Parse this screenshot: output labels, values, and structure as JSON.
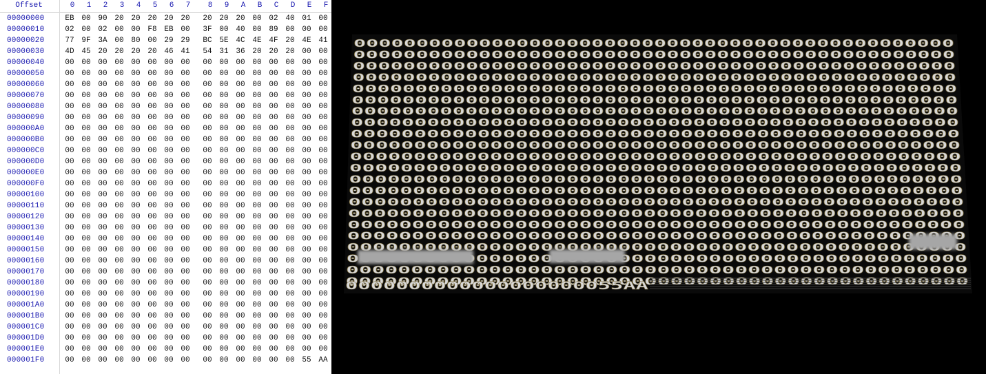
{
  "hex_editor": {
    "offset_header": "Offset",
    "column_headers": [
      "0",
      "1",
      "2",
      "3",
      "4",
      "5",
      "6",
      "7",
      "8",
      "9",
      "A",
      "B",
      "C",
      "D",
      "E",
      "F"
    ],
    "rows": [
      {
        "offset": "00000000",
        "bytes": [
          "EB",
          "00",
          "90",
          "20",
          "20",
          "20",
          "20",
          "20",
          "20",
          "20",
          "20",
          "00",
          "02",
          "40",
          "01",
          "00"
        ]
      },
      {
        "offset": "00000010",
        "bytes": [
          "02",
          "00",
          "02",
          "00",
          "00",
          "F8",
          "EB",
          "00",
          "3F",
          "00",
          "40",
          "00",
          "89",
          "00",
          "00",
          "00"
        ]
      },
      {
        "offset": "00000020",
        "bytes": [
          "77",
          "9F",
          "3A",
          "00",
          "80",
          "00",
          "29",
          "29",
          "BC",
          "5E",
          "4C",
          "4E",
          "4F",
          "20",
          "4E",
          "41"
        ]
      },
      {
        "offset": "00000030",
        "bytes": [
          "4D",
          "45",
          "20",
          "20",
          "20",
          "20",
          "46",
          "41",
          "54",
          "31",
          "36",
          "20",
          "20",
          "20",
          "00",
          "00"
        ]
      },
      {
        "offset": "00000040",
        "bytes": [
          "00",
          "00",
          "00",
          "00",
          "00",
          "00",
          "00",
          "00",
          "00",
          "00",
          "00",
          "00",
          "00",
          "00",
          "00",
          "00"
        ]
      },
      {
        "offset": "00000050",
        "bytes": [
          "00",
          "00",
          "00",
          "00",
          "00",
          "00",
          "00",
          "00",
          "00",
          "00",
          "00",
          "00",
          "00",
          "00",
          "00",
          "00"
        ]
      },
      {
        "offset": "00000060",
        "bytes": [
          "00",
          "00",
          "00",
          "00",
          "00",
          "00",
          "00",
          "00",
          "00",
          "00",
          "00",
          "00",
          "00",
          "00",
          "00",
          "00"
        ]
      },
      {
        "offset": "00000070",
        "bytes": [
          "00",
          "00",
          "00",
          "00",
          "00",
          "00",
          "00",
          "00",
          "00",
          "00",
          "00",
          "00",
          "00",
          "00",
          "00",
          "00"
        ]
      },
      {
        "offset": "00000080",
        "bytes": [
          "00",
          "00",
          "00",
          "00",
          "00",
          "00",
          "00",
          "00",
          "00",
          "00",
          "00",
          "00",
          "00",
          "00",
          "00",
          "00"
        ]
      },
      {
        "offset": "00000090",
        "bytes": [
          "00",
          "00",
          "00",
          "00",
          "00",
          "00",
          "00",
          "00",
          "00",
          "00",
          "00",
          "00",
          "00",
          "00",
          "00",
          "00"
        ]
      },
      {
        "offset": "000000A0",
        "bytes": [
          "00",
          "00",
          "00",
          "00",
          "00",
          "00",
          "00",
          "00",
          "00",
          "00",
          "00",
          "00",
          "00",
          "00",
          "00",
          "00"
        ]
      },
      {
        "offset": "000000B0",
        "bytes": [
          "00",
          "00",
          "00",
          "00",
          "00",
          "00",
          "00",
          "00",
          "00",
          "00",
          "00",
          "00",
          "00",
          "00",
          "00",
          "00"
        ]
      },
      {
        "offset": "000000C0",
        "bytes": [
          "00",
          "00",
          "00",
          "00",
          "00",
          "00",
          "00",
          "00",
          "00",
          "00",
          "00",
          "00",
          "00",
          "00",
          "00",
          "00"
        ]
      },
      {
        "offset": "000000D0",
        "bytes": [
          "00",
          "00",
          "00",
          "00",
          "00",
          "00",
          "00",
          "00",
          "00",
          "00",
          "00",
          "00",
          "00",
          "00",
          "00",
          "00"
        ]
      },
      {
        "offset": "000000E0",
        "bytes": [
          "00",
          "00",
          "00",
          "00",
          "00",
          "00",
          "00",
          "00",
          "00",
          "00",
          "00",
          "00",
          "00",
          "00",
          "00",
          "00"
        ]
      },
      {
        "offset": "000000F0",
        "bytes": [
          "00",
          "00",
          "00",
          "00",
          "00",
          "00",
          "00",
          "00",
          "00",
          "00",
          "00",
          "00",
          "00",
          "00",
          "00",
          "00"
        ]
      },
      {
        "offset": "00000100",
        "bytes": [
          "00",
          "00",
          "00",
          "00",
          "00",
          "00",
          "00",
          "00",
          "00",
          "00",
          "00",
          "00",
          "00",
          "00",
          "00",
          "00"
        ]
      },
      {
        "offset": "00000110",
        "bytes": [
          "00",
          "00",
          "00",
          "00",
          "00",
          "00",
          "00",
          "00",
          "00",
          "00",
          "00",
          "00",
          "00",
          "00",
          "00",
          "00"
        ]
      },
      {
        "offset": "00000120",
        "bytes": [
          "00",
          "00",
          "00",
          "00",
          "00",
          "00",
          "00",
          "00",
          "00",
          "00",
          "00",
          "00",
          "00",
          "00",
          "00",
          "00"
        ]
      },
      {
        "offset": "00000130",
        "bytes": [
          "00",
          "00",
          "00",
          "00",
          "00",
          "00",
          "00",
          "00",
          "00",
          "00",
          "00",
          "00",
          "00",
          "00",
          "00",
          "00"
        ]
      },
      {
        "offset": "00000140",
        "bytes": [
          "00",
          "00",
          "00",
          "00",
          "00",
          "00",
          "00",
          "00",
          "00",
          "00",
          "00",
          "00",
          "00",
          "00",
          "00",
          "00"
        ]
      },
      {
        "offset": "00000150",
        "bytes": [
          "00",
          "00",
          "00",
          "00",
          "00",
          "00",
          "00",
          "00",
          "00",
          "00",
          "00",
          "00",
          "00",
          "00",
          "00",
          "00"
        ]
      },
      {
        "offset": "00000160",
        "bytes": [
          "00",
          "00",
          "00",
          "00",
          "00",
          "00",
          "00",
          "00",
          "00",
          "00",
          "00",
          "00",
          "00",
          "00",
          "00",
          "00"
        ]
      },
      {
        "offset": "00000170",
        "bytes": [
          "00",
          "00",
          "00",
          "00",
          "00",
          "00",
          "00",
          "00",
          "00",
          "00",
          "00",
          "00",
          "00",
          "00",
          "00",
          "00"
        ]
      },
      {
        "offset": "00000180",
        "bytes": [
          "00",
          "00",
          "00",
          "00",
          "00",
          "00",
          "00",
          "00",
          "00",
          "00",
          "00",
          "00",
          "00",
          "00",
          "00",
          "00"
        ]
      },
      {
        "offset": "00000190",
        "bytes": [
          "00",
          "00",
          "00",
          "00",
          "00",
          "00",
          "00",
          "00",
          "00",
          "00",
          "00",
          "00",
          "00",
          "00",
          "00",
          "00"
        ]
      },
      {
        "offset": "000001A0",
        "bytes": [
          "00",
          "00",
          "00",
          "00",
          "00",
          "00",
          "00",
          "00",
          "00",
          "00",
          "00",
          "00",
          "00",
          "00",
          "00",
          "00"
        ]
      },
      {
        "offset": "000001B0",
        "bytes": [
          "00",
          "00",
          "00",
          "00",
          "00",
          "00",
          "00",
          "00",
          "00",
          "00",
          "00",
          "00",
          "00",
          "00",
          "00",
          "00"
        ]
      },
      {
        "offset": "000001C0",
        "bytes": [
          "00",
          "00",
          "00",
          "00",
          "00",
          "00",
          "00",
          "00",
          "00",
          "00",
          "00",
          "00",
          "00",
          "00",
          "00",
          "00"
        ]
      },
      {
        "offset": "000001D0",
        "bytes": [
          "00",
          "00",
          "00",
          "00",
          "00",
          "00",
          "00",
          "00",
          "00",
          "00",
          "00",
          "00",
          "00",
          "00",
          "00",
          "00"
        ]
      },
      {
        "offset": "000001E0",
        "bytes": [
          "00",
          "00",
          "00",
          "00",
          "00",
          "00",
          "00",
          "00",
          "00",
          "00",
          "00",
          "00",
          "00",
          "00",
          "00",
          "00"
        ]
      },
      {
        "offset": "000001F0",
        "bytes": [
          "00",
          "00",
          "00",
          "00",
          "00",
          "00",
          "00",
          "00",
          "00",
          "00",
          "00",
          "00",
          "00",
          "00",
          "55",
          "AA"
        ]
      }
    ]
  },
  "photo_display": {
    "zero_glyph": "0",
    "zero_rows": 22,
    "last_line_text": "0000000000000000000055AA",
    "colors": {
      "screen_bg": "#0a0a0a",
      "glyph": "#d8d8d8",
      "glyph_shadow": "#7a6a3a",
      "blur_patch": "#a6a6a6"
    }
  }
}
